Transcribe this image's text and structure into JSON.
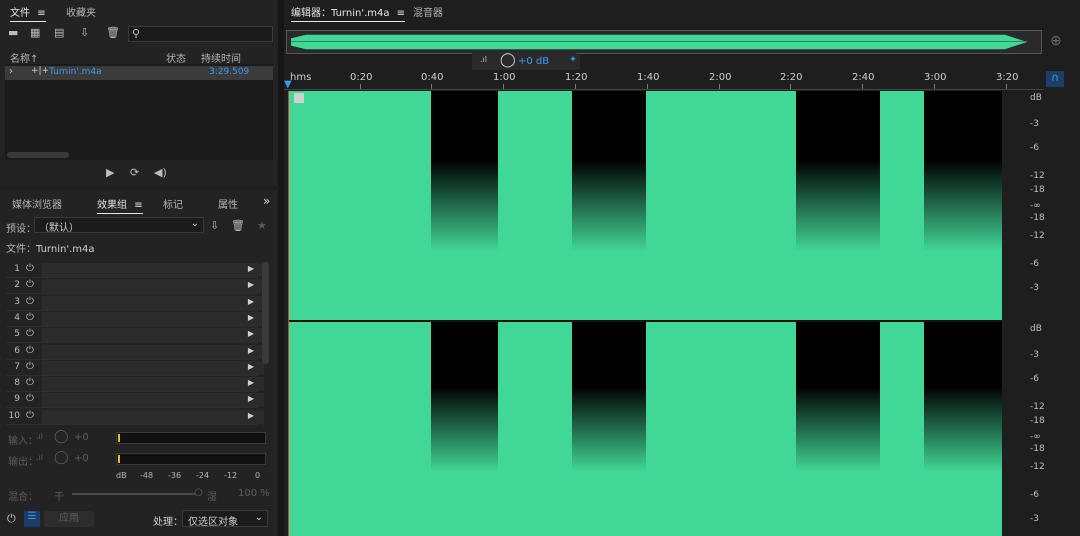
{
  "files_panel": {
    "tabs": [
      "文件",
      "收藏夹"
    ],
    "columns": {
      "name": "名称",
      "sort_arrow": "↑",
      "status": "状态",
      "duration": "持续时间"
    },
    "file": {
      "name": "Turnin'.m4a",
      "duration": "3:29.509"
    },
    "toolbar_icons": [
      "open-folder-icon",
      "import-icon",
      "new-file-icon",
      "export-icon",
      "delete-icon",
      "search-icon"
    ]
  },
  "effects_panel": {
    "tabs": [
      "媒体浏览器",
      "效果组",
      "标记",
      "属性"
    ],
    "preset_label": "预设：",
    "preset_value": "（默认）",
    "file_label": "文件：",
    "file_name": "Turnin'.m4a",
    "slots": [
      "1",
      "2",
      "3",
      "4",
      "5",
      "6",
      "7",
      "8",
      "9",
      "10"
    ],
    "input_label": "输入：",
    "input_value": "+0",
    "output_label": "输出：",
    "output_value": "+0",
    "meter_scale": [
      "dB",
      "-48",
      "-36",
      "-24",
      "-12",
      "0"
    ],
    "mix_label": "混合：",
    "mix_dry": "干",
    "mix_wet": "湿",
    "mix_value": "100 %",
    "apply_label": "应用",
    "process_label": "处理：",
    "process_value": "仅选区对象"
  },
  "editor": {
    "tab_editor": "编辑器：Turnin'.m4a",
    "tab_mixer": "混音器",
    "hud_volume": "+0 dB",
    "time_unit": "hms",
    "time_ticks": [
      "0:20",
      "0:40",
      "1:00",
      "1:20",
      "1:40",
      "2:00",
      "2:20",
      "2:40",
      "3:00",
      "3:20"
    ],
    "db_scale_top": [
      "dB",
      "-3",
      "-6",
      "-12",
      "-18",
      "-∞",
      "-18",
      "-12",
      "-6",
      "-3"
    ],
    "db_scale_bottom": [
      "dB",
      "-3",
      "-6",
      "-12",
      "-18",
      "-∞",
      "-18",
      "-12",
      "-6",
      "-3"
    ],
    "waveform_color": "#41d797"
  }
}
